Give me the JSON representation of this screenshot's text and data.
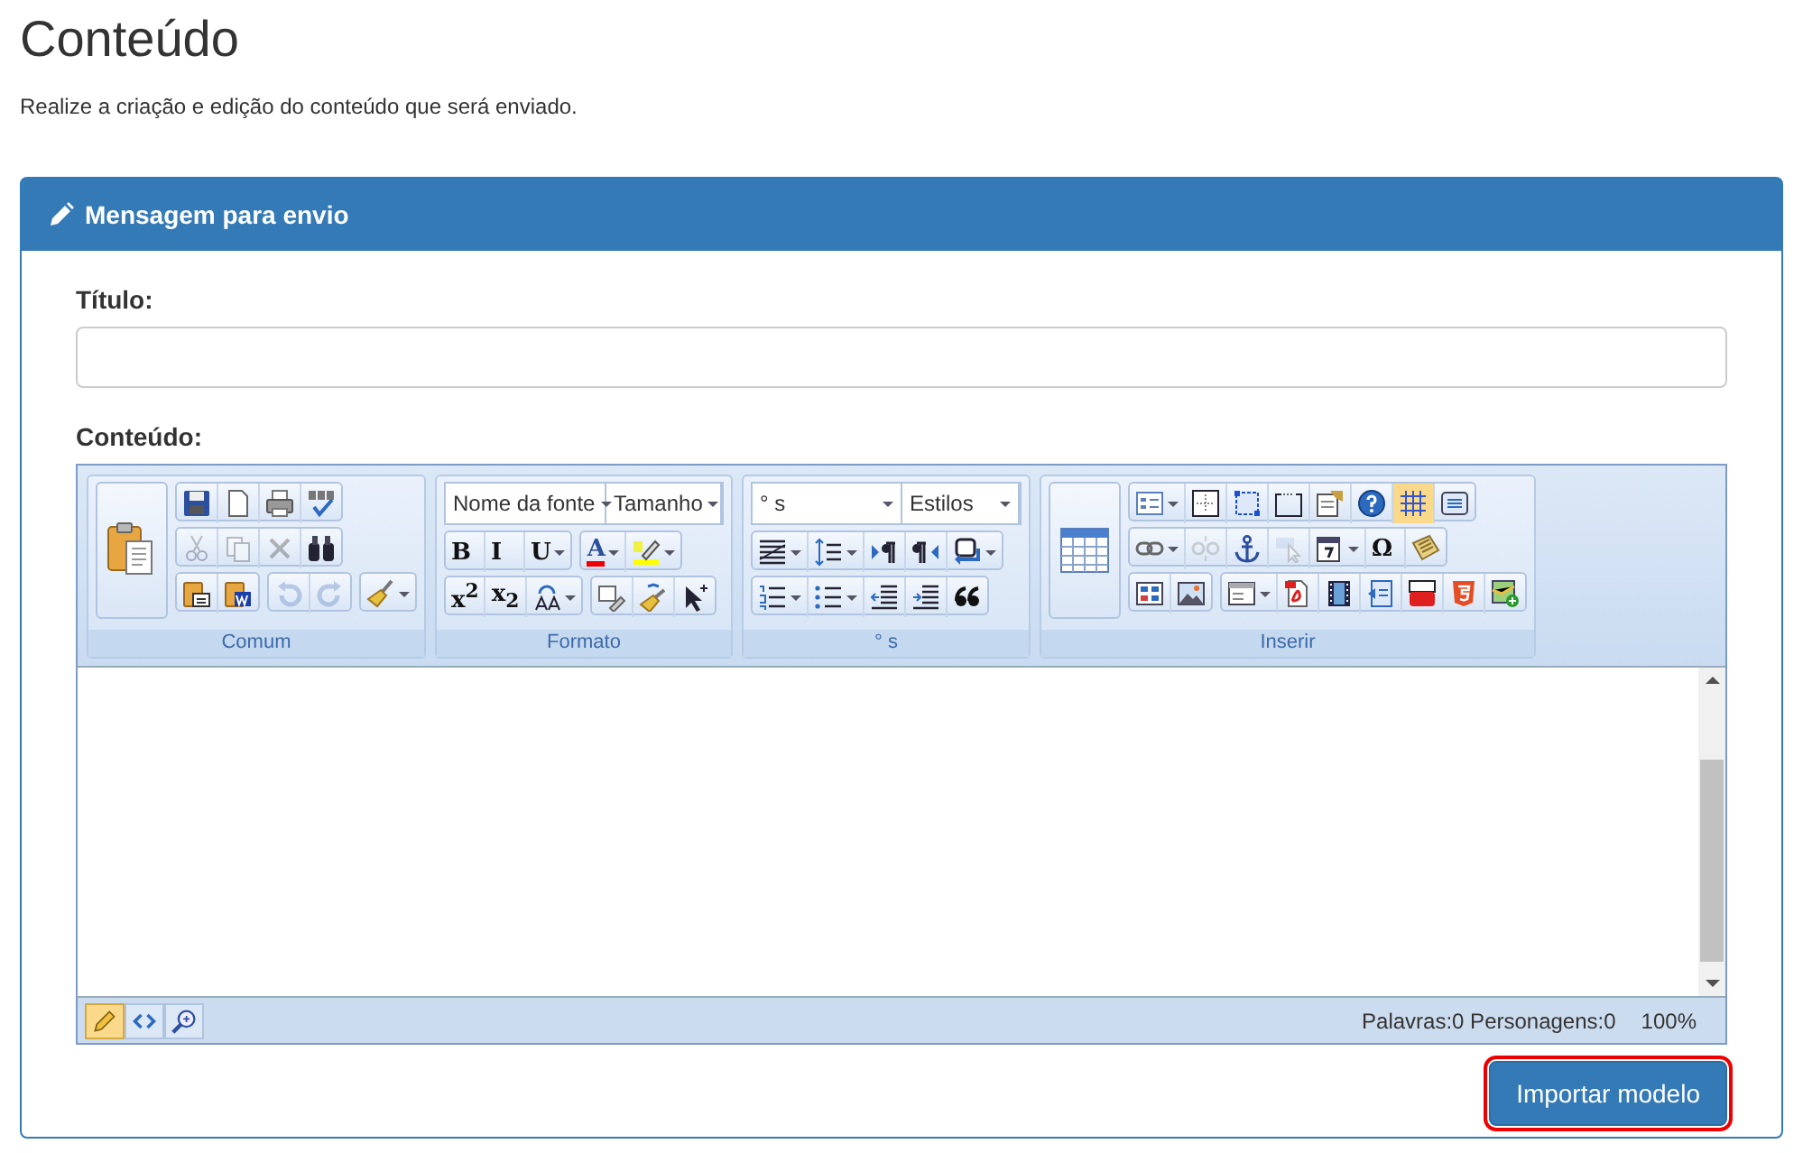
{
  "page": {
    "title": "Conteúdo",
    "subtitle": "Realize a criação e edição do conteúdo que será enviado."
  },
  "panel": {
    "title": "Mensagem para envio"
  },
  "title_field": {
    "label": "Título:"
  },
  "content_field": {
    "label": "Conteúdo:"
  },
  "editor": {
    "groups": [
      {
        "label": "Comum",
        "large": {
          "kind": "paste"
        },
        "rows": [
          [
            [
              {
                "kind": "save",
                "disabled": false,
                "on": false,
                "dropdown": false
              },
              {
                "kind": "new",
                "disabled": false,
                "on": false,
                "dropdown": false
              },
              {
                "kind": "print",
                "disabled": false,
                "on": false,
                "dropdown": false
              },
              {
                "kind": "spell",
                "disabled": false,
                "on": false,
                "dropdown": false
              }
            ]
          ],
          [
            [
              {
                "kind": "cut",
                "disabled": true,
                "on": false,
                "dropdown": false
              },
              {
                "kind": "copy",
                "disabled": true,
                "on": false,
                "dropdown": false
              },
              {
                "kind": "delete",
                "disabled": true,
                "on": false,
                "dropdown": false
              },
              {
                "kind": "find",
                "disabled": false,
                "on": false,
                "dropdown": false
              }
            ]
          ],
          [
            [
              {
                "kind": "pastetext",
                "disabled": false,
                "on": false,
                "dropdown": false
              },
              {
                "kind": "pasteword",
                "disabled": false,
                "on": false,
                "dropdown": false
              }
            ],
            [
              {
                "kind": "undo",
                "disabled": true,
                "on": false,
                "dropdown": false
              },
              {
                "kind": "redo",
                "disabled": true,
                "on": false,
                "dropdown": false
              }
            ],
            [
              {
                "kind": "clean",
                "disabled": false,
                "on": false,
                "dropdown": true
              }
            ]
          ]
        ]
      },
      {
        "label": "Formato",
        "selects": [
          "Nome da fonte",
          "Tamanho"
        ],
        "rows": [
          [
            [
              {
                "kind": "text",
                "label": "B",
                "disabled": false,
                "on": false,
                "dropdown": false
              },
              {
                "kind": "text",
                "label": "I",
                "disabled": false,
                "on": false,
                "dropdown": false
              },
              {
                "kind": "text",
                "label": "U",
                "disabled": false,
                "on": false,
                "dropdown": true
              }
            ],
            [
              {
                "kind": "fontcolor",
                "label": "A",
                "disabled": false,
                "on": false,
                "dropdown": true
              },
              {
                "kind": "highlight",
                "disabled": false,
                "on": false,
                "dropdown": true
              }
            ]
          ],
          [
            [
              {
                "kind": "text",
                "label": "x$^{2}$",
                "disabled": false,
                "on": false,
                "dropdown": false
              },
              {
                "kind": "text",
                "label": "x$_{2}$",
                "disabled": false,
                "on": false,
                "dropdown": false
              },
              {
                "kind": "case",
                "disabled": false,
                "on": false,
                "dropdown": true
              }
            ],
            [
              {
                "kind": "eraser",
                "disabled": false,
                "on": false,
                "dropdown": false
              },
              {
                "kind": "painter",
                "disabled": false,
                "on": false,
                "dropdown": false
              },
              {
                "kind": "select",
                "disabled": false,
                "on": false,
                "dropdown": false
              }
            ]
          ]
        ]
      },
      {
        "label": "° s",
        "selects": [
          "° s",
          "Estilos"
        ],
        "rows": [
          [
            [
              {
                "kind": "align",
                "disabled": false,
                "on": false,
                "dropdown": true
              },
              {
                "kind": "spacing",
                "disabled": false,
                "on": false,
                "dropdown": true
              },
              {
                "kind": "ltr",
                "disabled": false,
                "on": false,
                "dropdown": false
              },
              {
                "kind": "rtl",
                "disabled": false,
                "on": false,
                "dropdown": false
              },
              {
                "kind": "br",
                "disabled": false,
                "on": false,
                "dropdown": true
              }
            ]
          ],
          [
            [
              {
                "kind": "ol",
                "disabled": false,
                "on": false,
                "dropdown": true
              },
              {
                "kind": "ul",
                "disabled": false,
                "on": false,
                "dropdown": true
              },
              {
                "kind": "outdent",
                "disabled": false,
                "on": false,
                "dropdown": false
              },
              {
                "kind": "indent",
                "disabled": false,
                "on": false,
                "dropdown": false
              },
              {
                "kind": "quote",
                "disabled": false,
                "on": false,
                "dropdown": false
              }
            ]
          ]
        ]
      },
      {
        "label": "Inserir",
        "large": {
          "kind": "table"
        },
        "rows": [
          [
            [
              {
                "kind": "form",
                "disabled": false,
                "on": false,
                "dropdown": true
              },
              {
                "kind": "cell",
                "disabled": false,
                "on": false,
                "dropdown": false
              },
              {
                "kind": "div",
                "disabled": false,
                "on": false,
                "dropdown": false
              },
              {
                "kind": "fieldset",
                "disabled": false,
                "on": false,
                "dropdown": false
              },
              {
                "kind": "template",
                "disabled": false,
                "on": false,
                "dropdown": false
              },
              {
                "kind": "help",
                "disabled": false,
                "on": false,
                "dropdown": false
              },
              {
                "kind": "grid",
                "disabled": false,
                "on": true,
                "dropdown": false
              },
              {
                "kind": "iframe",
                "disabled": false,
                "on": false,
                "dropdown": false
              }
            ]
          ],
          [
            [
              {
                "kind": "link",
                "disabled": false,
                "on": false,
                "dropdown": true
              },
              {
                "kind": "unlink",
                "disabled": true,
                "on": false,
                "dropdown": false
              },
              {
                "kind": "anchor",
                "disabled": false,
                "on": false,
                "dropdown": false
              },
              {
                "kind": "imagemap",
                "disabled": true,
                "on": false,
                "dropdown": false
              },
              {
                "kind": "date",
                "disabled": false,
                "on": false,
                "dropdown": true
              },
              {
                "kind": "text",
                "label": "Ω",
                "disabled": false,
                "on": false,
                "dropdown": false
              },
              {
                "kind": "keyboard",
                "disabled": false,
                "on": false,
                "dropdown": false
              }
            ]
          ],
          [
            [
              {
                "kind": "tablesplit",
                "disabled": false,
                "on": false,
                "dropdown": false
              },
              {
                "kind": "image",
                "disabled": false,
                "on": false,
                "dropdown": false
              }
            ],
            [
              {
                "kind": "layout",
                "disabled": false,
                "on": false,
                "dropdown": true
              },
              {
                "kind": "pdf",
                "disabled": false,
                "on": false,
                "dropdown": false
              },
              {
                "kind": "video",
                "disabled": false,
                "on": false,
                "dropdown": false
              },
              {
                "kind": "flash",
                "disabled": false,
                "on": false,
                "dropdown": false
              },
              {
                "kind": "youtube",
                "disabled": false,
                "on": false,
                "dropdown": false
              },
              {
                "kind": "html5",
                "disabled": false,
                "on": false,
                "dropdown": false
              },
              {
                "kind": "map",
                "disabled": false,
                "on": false,
                "dropdown": false
              }
            ]
          ]
        ]
      }
    ],
    "modes": [
      {
        "kind": "design",
        "selected": true
      },
      {
        "kind": "code",
        "selected": false
      },
      {
        "kind": "preview",
        "selected": false
      }
    ],
    "stats": "Palavras:0 Personagens:0",
    "zoom": "100%"
  },
  "buttons": [
    {
      "label": "Importar modelo",
      "highlighted": true
    }
  ]
}
